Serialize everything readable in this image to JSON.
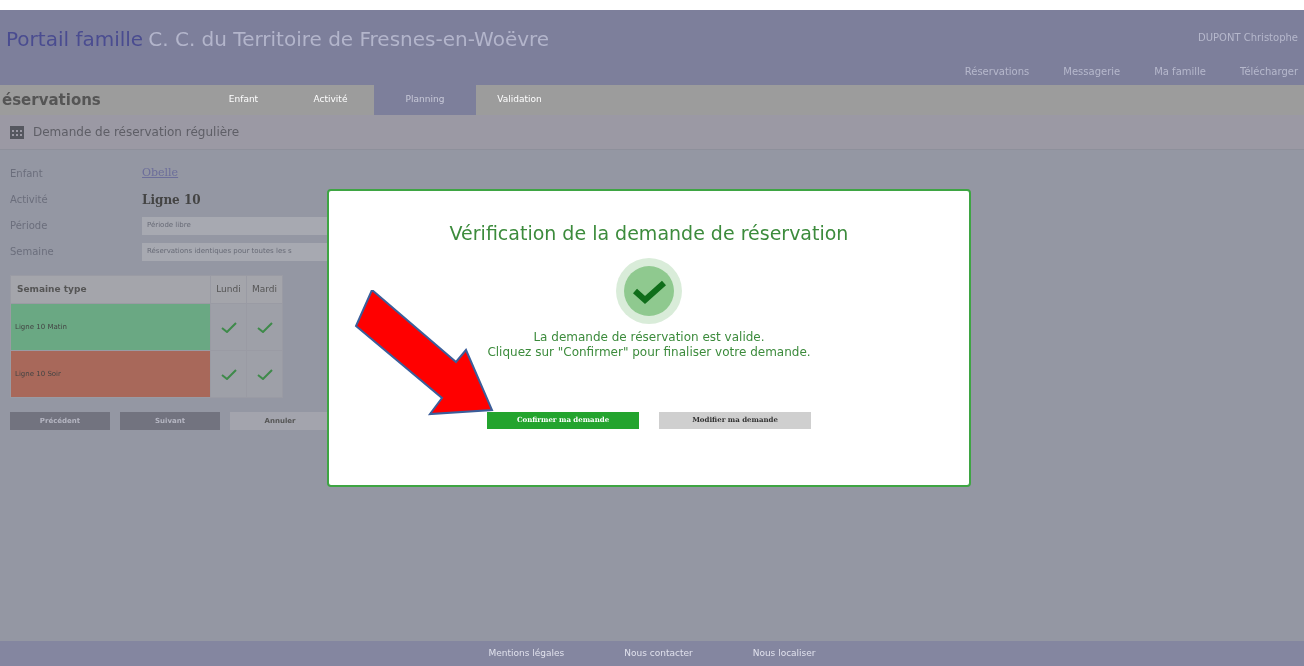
{
  "header": {
    "brand": "Portail famille",
    "site": "C. C. du Territoire de Fresnes-en-Woëvre",
    "user": "DUPONT Christophe",
    "nav": [
      "Réservations",
      "Messagerie",
      "Ma famille",
      "Télécharger"
    ]
  },
  "steps_bar": {
    "title": "éservations",
    "steps": [
      {
        "label": "Enfant",
        "selected": false
      },
      {
        "label": "Activité",
        "selected": false
      },
      {
        "label": "Planning",
        "selected": true
      },
      {
        "label": "Validation",
        "selected": false
      }
    ]
  },
  "section_title": "Demande de réservation régulière",
  "form": [
    {
      "label": "Enfant",
      "kind": "link",
      "value": "Obelle"
    },
    {
      "label": "Activité",
      "kind": "bold",
      "value": "Ligne 10"
    },
    {
      "label": "Période",
      "kind": "select",
      "value": "Période libre"
    },
    {
      "label": "Semaine",
      "kind": "select",
      "value": "Réservations identiques pour toutes les s"
    }
  ],
  "table": {
    "columns": [
      "Semaine type",
      "Lundi",
      "Mardi"
    ],
    "rows": [
      {
        "name": "Ligne 10 Matin",
        "color": "#6aa883",
        "days": [
          {
            "checked": true
          },
          {
            "checked": true
          }
        ]
      },
      {
        "name": "Ligne 10 Soir",
        "color": "#a8685a",
        "days": [
          {
            "checked": true
          },
          {
            "checked": true
          }
        ]
      }
    ]
  },
  "form_buttons": [
    "Précédent",
    "Suivant",
    "Annuler"
  ],
  "modal": {
    "title": "Vérification de la demande de réservation",
    "valid": true,
    "message": [
      "La demande de réservation est valide.",
      "Cliquez sur \"Confirmer\" pour finaliser votre demande."
    ],
    "buttons": [
      {
        "label": "Confirmer ma demande",
        "kind": "primary"
      },
      {
        "label": "Modifier ma demande",
        "kind": "secondary"
      }
    ]
  },
  "footer": [
    "Mentions légales",
    "Nous contacter",
    "Nous localiser"
  ]
}
